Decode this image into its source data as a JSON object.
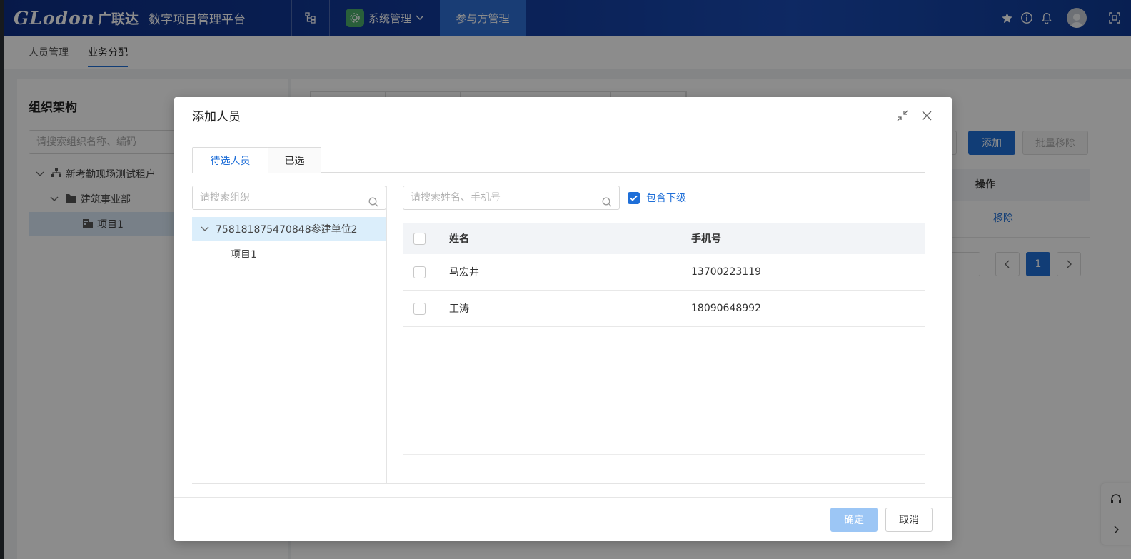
{
  "header": {
    "logo_en": "GLodon",
    "logo_cn": "广联达",
    "platform": "数字项目管理平台",
    "system_menu": "系统管理",
    "active_nav": "参与方管理"
  },
  "subtabs": [
    "人员管理",
    "业务分配"
  ],
  "background": {
    "org_title": "组织架构",
    "org_search_placeholder": "请搜索组织名称、编码",
    "tree": [
      "新考勤现场测试租户",
      "建筑事业部",
      "项目1"
    ],
    "add_button": "添加",
    "batch_remove_button": "批量移除",
    "op_header": "操作",
    "remove_link": "移除",
    "current_page": "1"
  },
  "modal": {
    "title": "添加人员",
    "tabs": [
      "待选人员",
      "已选"
    ],
    "org_search_placeholder": "请搜索组织",
    "org_tree": {
      "root": "758181875470848参建单位2",
      "child": "项目1"
    },
    "name_search_placeholder": "请搜索姓名、手机号",
    "include_sub_label": "包含下级",
    "include_sub_checked": true,
    "table": {
      "headers": [
        "姓名",
        "手机号"
      ],
      "rows": [
        {
          "name": "马宏井",
          "phone": "13700223119"
        },
        {
          "name": "王涛",
          "phone": "18090648992"
        }
      ]
    },
    "ok_button": "确定",
    "cancel_button": "取消"
  },
  "colors": {
    "primary": "#1f6fd8",
    "header_bg": "#123a9a",
    "nav_active": "#2f6fd6",
    "ok_disabled": "#9cc6f5"
  }
}
